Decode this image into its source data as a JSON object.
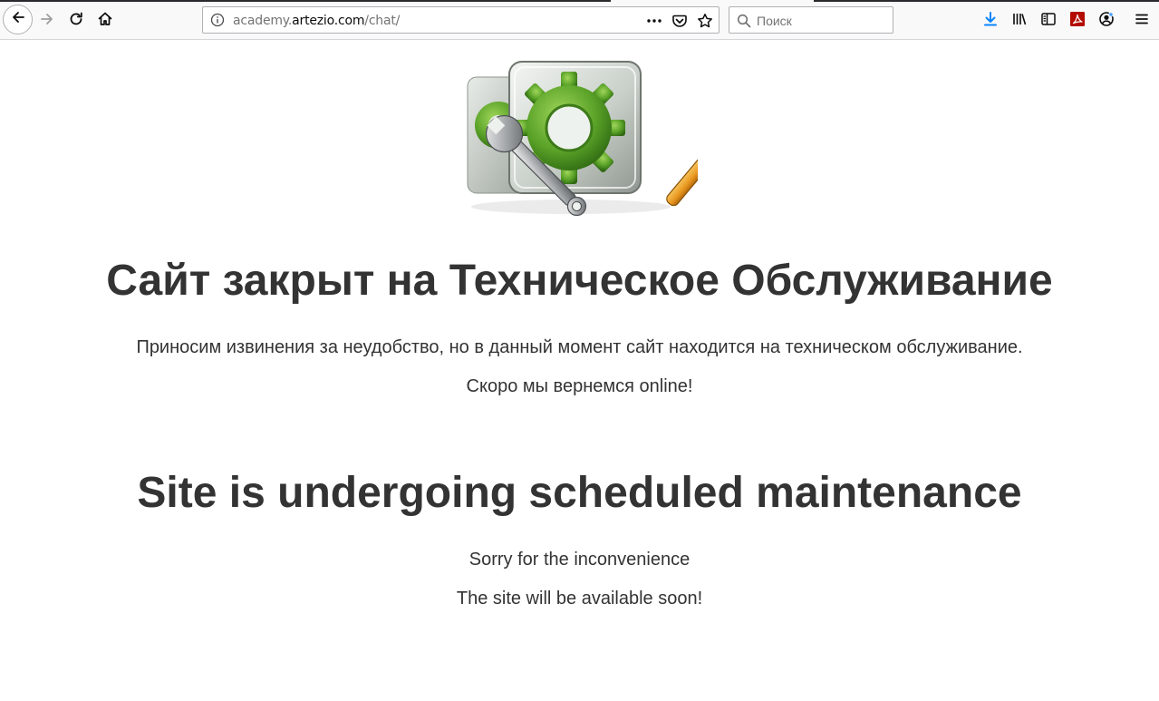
{
  "browser": {
    "url": {
      "prefix": "academy.",
      "domain": "artezio.com",
      "path": "/chat/"
    },
    "search": {
      "placeholder": "Поиск"
    },
    "icons": {
      "back": "arrow-left-icon",
      "forward": "arrow-right-icon",
      "reload": "reload-icon",
      "home": "home-icon",
      "site_info": "info-icon",
      "page_actions": "more-horizontal-icon",
      "pocket": "pocket-icon",
      "bookmark": "star-icon",
      "search": "search-icon",
      "downloads": "download-icon",
      "library": "library-icon",
      "sidebar": "sidebar-icon",
      "pdf_extension": "pdf-icon",
      "account": "account-icon",
      "menu": "hamburger-menu-icon"
    },
    "colors": {
      "download_accent": "#0a84ff",
      "pdf_red": "#b30b00"
    }
  },
  "page": {
    "illustration": "maintenance-gear-tools-icon",
    "ru": {
      "heading": "Сайт закрыт на Техническое Обслуживание",
      "line1": "Приносим извинения за неудобство, но в данный момент сайт находится на техническом обслуживание.",
      "line2": "Скоро мы вернемся online!"
    },
    "en": {
      "heading": "Site is undergoing scheduled maintenance",
      "line1": "Sorry for the inconvenience",
      "line2": "The site will be available soon!"
    },
    "colors": {
      "text": "#333333",
      "gear_green": "#5aa228",
      "tool_orange": "#e8961e"
    }
  }
}
